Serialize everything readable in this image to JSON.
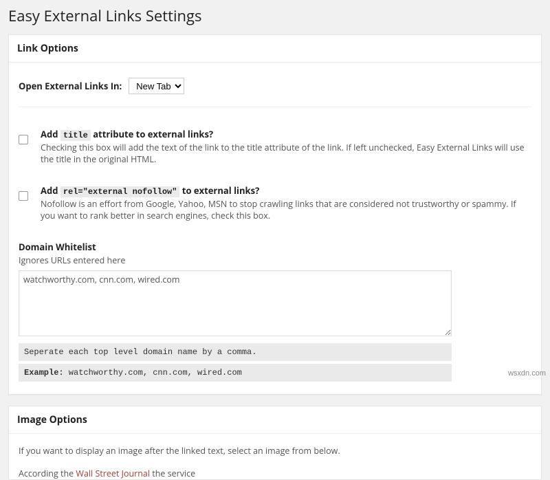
{
  "page": {
    "title": "Easy External Links Settings"
  },
  "linkOptions": {
    "heading": "Link Options",
    "openLabel": "Open External Links In:",
    "openSelected": "New Tab",
    "titleAttr": {
      "prefix": "Add ",
      "code": "title",
      "suffix": " attribute to external links?",
      "desc": "Checking this box will add the text of the link to the title attribute of the link. If left unchecked, Easy External Links will use the title in the original HTML."
    },
    "relAttr": {
      "prefix": "Add ",
      "code": "rel=\"external nofollow\"",
      "suffix": " to external links?",
      "desc": "Nofollow is an effort from Google, Yahoo, MSN to stop crawling links that are considered not trustworthy or spammy. If you want to rank better in search engines, check this box."
    },
    "whitelist": {
      "label": "Domain Whitelist",
      "ignores": "Ignores URLs entered here",
      "value": "watchworthy.com, cnn.com, wired.com",
      "hint1": "Seperate each top level domain name by a comma.",
      "hint2Label": "Example:",
      "hint2Value": " watchworthy.com, cnn.com, wired.com"
    }
  },
  "imageOptions": {
    "heading": "Image Options",
    "intro": "If you want to display an image after the linked text, select an image from below.",
    "cutoffA": "According the ",
    "cutoffRed": "Wall Street Journal",
    "cutoffB": " the service"
  },
  "watermark": "wsxdn.com"
}
